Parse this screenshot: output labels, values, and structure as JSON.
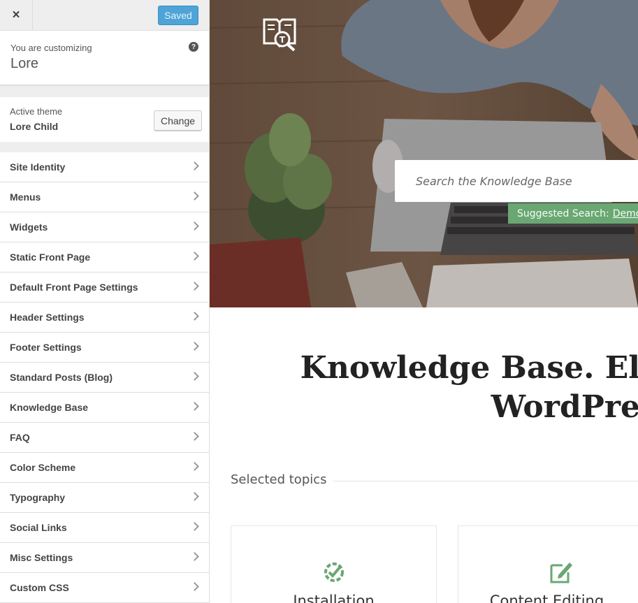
{
  "sidebar": {
    "close_label": "×",
    "saved_label": "Saved",
    "customizing_label": "You are customizing",
    "site_name": "Lore",
    "help_glyph": "?",
    "active_theme_label": "Active theme",
    "theme_name": "Lore Child",
    "change_label": "Change",
    "items": [
      {
        "label": "Site Identity"
      },
      {
        "label": "Menus"
      },
      {
        "label": "Widgets"
      },
      {
        "label": "Static Front Page"
      },
      {
        "label": "Default Front Page Settings"
      },
      {
        "label": "Header Settings"
      },
      {
        "label": "Footer Settings"
      },
      {
        "label": "Standard Posts (Blog)"
      },
      {
        "label": "Knowledge Base"
      },
      {
        "label": "FAQ"
      },
      {
        "label": "Color Scheme"
      },
      {
        "label": "Typography"
      },
      {
        "label": "Social Links"
      },
      {
        "label": "Misc Settings"
      },
      {
        "label": "Custom CSS"
      }
    ]
  },
  "preview": {
    "search_placeholder": "Search the Knowledge Base",
    "suggested_label": "Suggested Search:",
    "suggested_link": "Demo",
    "headline_line1": "Knowledge Base. El",
    "headline_line2": "WordPre",
    "topics_label": "Selected topics",
    "cards": [
      {
        "title": "Installation",
        "icon": "gear-check-icon"
      },
      {
        "title": "Content Editing",
        "icon": "edit-icon"
      }
    ]
  },
  "colors": {
    "accent_green": "#6aa773",
    "saved_blue": "#4ea3d7"
  }
}
